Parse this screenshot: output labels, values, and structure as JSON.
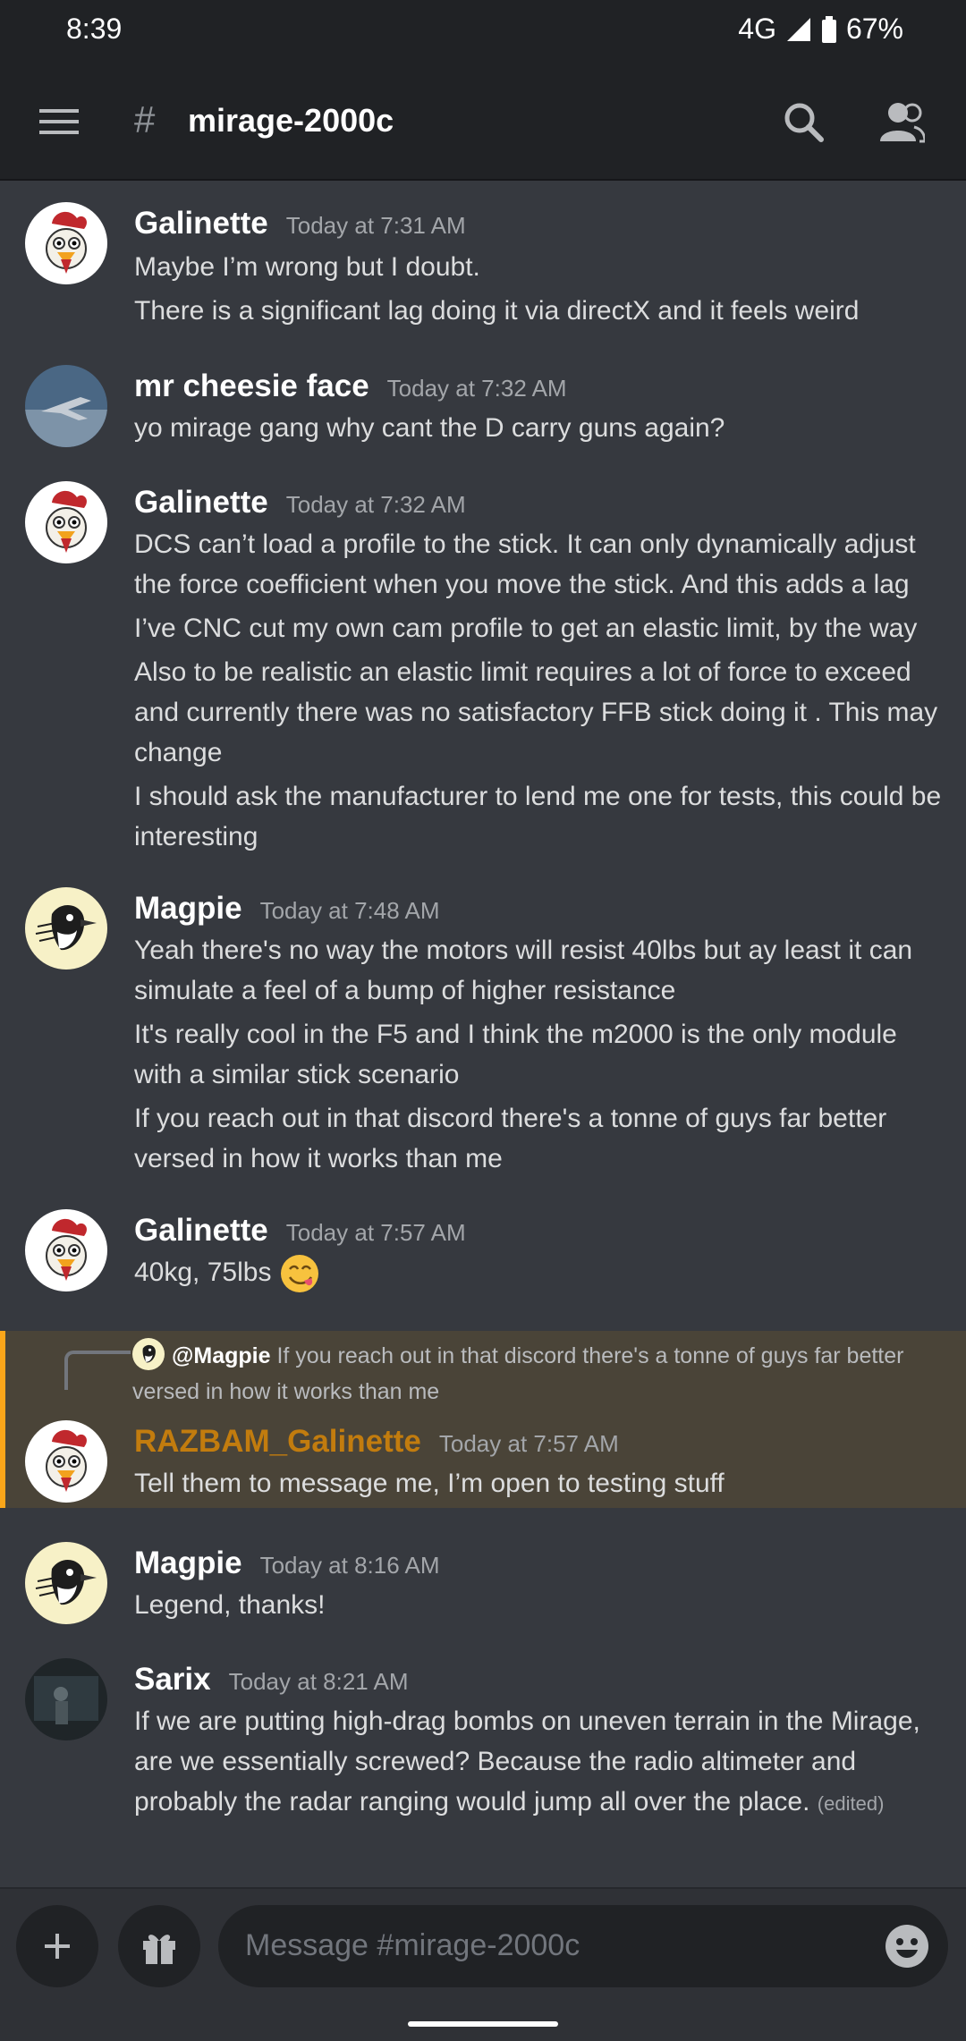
{
  "status": {
    "time": "8:39",
    "network": "4G",
    "battery": "67%"
  },
  "header": {
    "channel": "mirage-2000c",
    "icons": [
      "hamburger-menu-icon",
      "hash-icon",
      "search-icon",
      "members-icon"
    ]
  },
  "messages": [
    {
      "user": "Galinette",
      "time": "Today at 7:31 AM",
      "lines": [
        "Maybe I’m wrong but I doubt.",
        "There is a significant lag doing it via directX and it feels weird"
      ]
    },
    {
      "user": "mr cheesie face",
      "time": "Today at 7:32 AM",
      "lines": [
        "yo mirage gang why cant the D carry guns again?"
      ]
    },
    {
      "user": "Galinette",
      "time": "Today at 7:32 AM",
      "lines": [
        "DCS can’t load a profile to the stick. It can only dynamically adjust the force coefficient when you move the stick. And this adds a lag",
        "I’ve CNC cut my own cam profile to get an elastic limit, by the way",
        "Also to be realistic an elastic limit requires a lot of force to exceed and currently there was no satisfactory FFB stick doing it . This may change",
        "I should ask the manufacturer to lend me one for tests, this could be interesting"
      ]
    },
    {
      "user": "Magpie",
      "time": "Today at 7:48 AM",
      "lines": [
        "Yeah there's no way the motors will resist 40lbs but ay least it can simulate a feel of a bump of higher resistance",
        "It's really cool in the F5 and I think the m2000 is the only module with a similar stick scenario",
        "If you reach out in that discord there's a tonne of guys far better versed in how it works than me"
      ]
    },
    {
      "user": "Galinette",
      "time": "Today at 7:57 AM",
      "lines": [
        "40kg, 75lbs"
      ],
      "emoji": "savoring-food-emoji"
    },
    {
      "user": "RAZBAM_Galinette",
      "time": "Today at 7:57 AM",
      "lines": [
        "Tell them to message me, I’m open to testing stuff"
      ],
      "user_color": "#c27c0e",
      "reply": {
        "mention": "@Magpie",
        "text": "If you reach out in that discord there's a tonne of guys far better versed in how it works than me"
      }
    },
    {
      "user": "Magpie",
      "time": "Today at 8:16 AM",
      "lines": [
        "Legend, thanks!"
      ]
    },
    {
      "user": "Sarix",
      "time": "Today at 8:21 AM",
      "lines": [
        "If we are putting high-drag bombs on uneven terrain in the Mirage, are we essentially screwed? Because the radio altimeter and probably the radar ranging would jump all over the place."
      ],
      "edited": "(edited)"
    }
  ],
  "composer": {
    "placeholder": "Message #mirage-2000c",
    "icons": [
      "plus-icon",
      "gift-icon",
      "emoji-icon"
    ]
  },
  "colors": {
    "background": "#36393f",
    "header": "#202225",
    "highlight": "#4a4438",
    "highlight_bar": "#faa61a",
    "mention_user": "#c27c0e"
  }
}
